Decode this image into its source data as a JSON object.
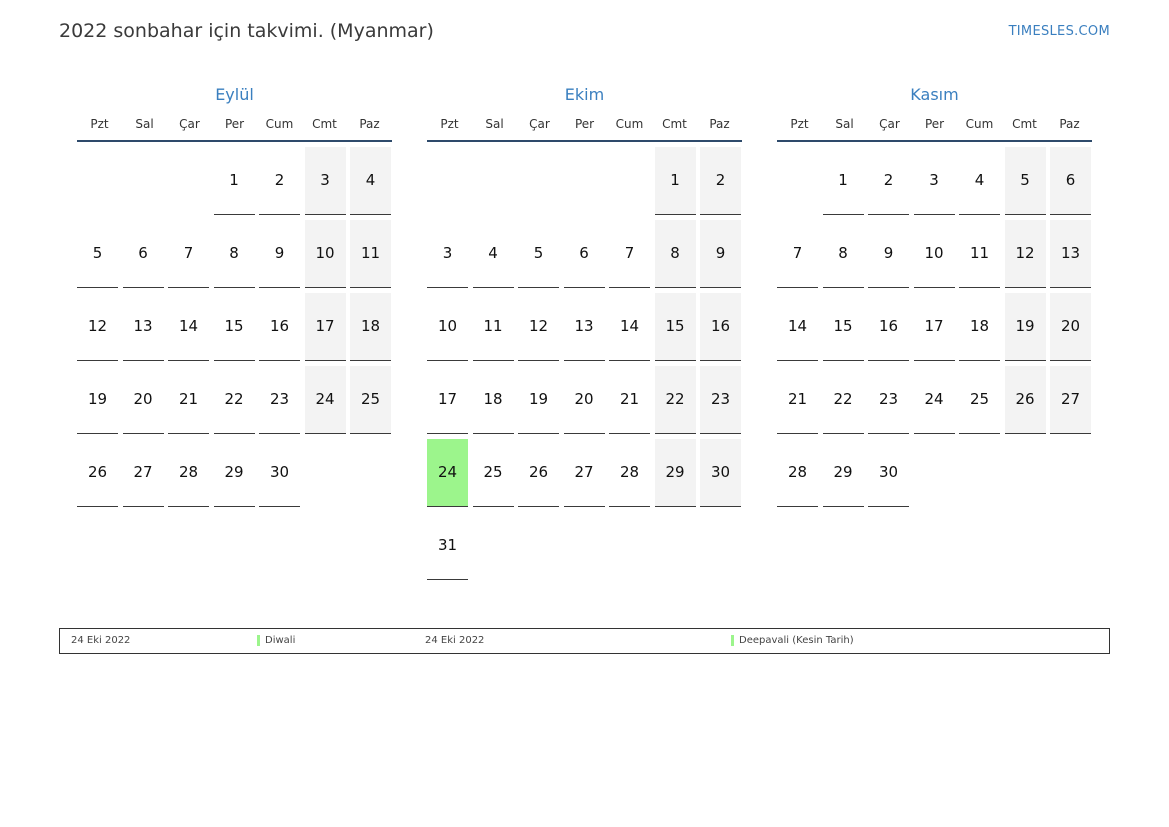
{
  "header": {
    "title": "2022 sonbahar için takvimi. (Myanmar)",
    "brand": "TIMESLES.COM"
  },
  "weekdays": [
    "Pzt",
    "Sal",
    "Çar",
    "Per",
    "Cum",
    "Cmt",
    "Paz"
  ],
  "months": [
    {
      "name": "Eylül",
      "weeks": [
        [
          null,
          null,
          null,
          "1",
          "2",
          "3",
          "4"
        ],
        [
          "5",
          "6",
          "7",
          "8",
          "9",
          "10",
          "11"
        ],
        [
          "12",
          "13",
          "14",
          "15",
          "16",
          "17",
          "18"
        ],
        [
          "19",
          "20",
          "21",
          "22",
          "23",
          "24",
          "25"
        ],
        [
          "26",
          "27",
          "28",
          "29",
          "30",
          null,
          null
        ]
      ],
      "holidays": []
    },
    {
      "name": "Ekim",
      "weeks": [
        [
          null,
          null,
          null,
          null,
          null,
          "1",
          "2"
        ],
        [
          "3",
          "4",
          "5",
          "6",
          "7",
          "8",
          "9"
        ],
        [
          "10",
          "11",
          "12",
          "13",
          "14",
          "15",
          "16"
        ],
        [
          "17",
          "18",
          "19",
          "20",
          "21",
          "22",
          "23"
        ],
        [
          "24",
          "25",
          "26",
          "27",
          "28",
          "29",
          "30"
        ],
        [
          "31",
          null,
          null,
          null,
          null,
          null,
          null
        ]
      ],
      "holidays": [
        "24"
      ]
    },
    {
      "name": "Kasım",
      "weeks": [
        [
          null,
          "1",
          "2",
          "3",
          "4",
          "5",
          "6"
        ],
        [
          "7",
          "8",
          "9",
          "10",
          "11",
          "12",
          "13"
        ],
        [
          "14",
          "15",
          "16",
          "17",
          "18",
          "19",
          "20"
        ],
        [
          "21",
          "22",
          "23",
          "24",
          "25",
          "26",
          "27"
        ],
        [
          "28",
          "29",
          "30",
          null,
          null,
          null,
          null
        ]
      ],
      "holidays": []
    }
  ],
  "legend": [
    {
      "date": "24 Eki 2022",
      "name": "Diwali"
    },
    {
      "date": "24 Eki 2022",
      "name": "Deepavali (Kesin Tarih)"
    }
  ],
  "colors": {
    "holiday": "#9cf58c",
    "weekend": "#f3f3f3",
    "accent": "#3a7fbf",
    "rule": "#2e4a6b"
  }
}
